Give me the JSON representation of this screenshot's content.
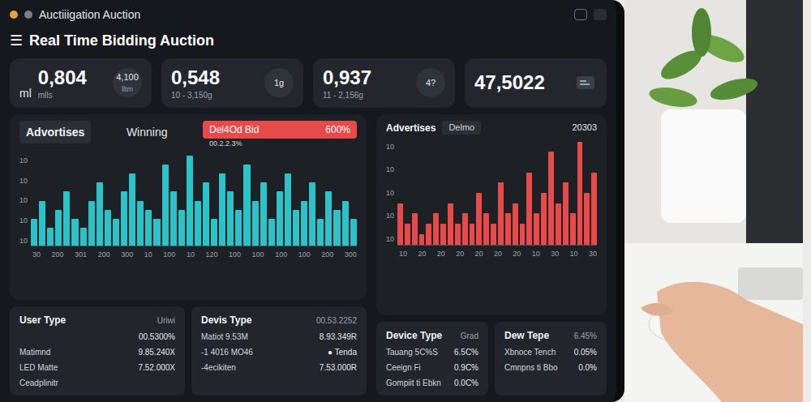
{
  "window": {
    "title": "Auctiiigation Auction"
  },
  "header": {
    "menu_icon": "☰",
    "title": "Real Time Bidding Auction"
  },
  "stats": [
    {
      "prefix": "ml",
      "value": "0,804",
      "sub": "mlls",
      "side": "4,100",
      "side_sub": "lltm"
    },
    {
      "value": "0,548",
      "sub": "10 - 3,150g",
      "side": "1g"
    },
    {
      "value": "0,937",
      "sub": "11 - 2,156g",
      "side": "4?"
    },
    {
      "value": "47,5022"
    }
  ],
  "main_chart": {
    "title": "Advortises",
    "status": "Winning",
    "badge": {
      "label": "Del4Od Bid",
      "value": "600%",
      "sub": "00.2.2.3%"
    },
    "y_ticks": [
      "10",
      "10",
      "10",
      "10",
      "10"
    ],
    "x_ticks": [
      "30",
      "200",
      "301",
      "200",
      "300",
      "10",
      "100",
      "10",
      "120",
      "100",
      "100",
      "100",
      "100",
      "200",
      "300"
    ],
    "color": "#2cc3c8",
    "values": [
      3,
      5,
      2,
      4,
      6,
      3,
      2,
      5,
      7,
      4,
      3,
      6,
      8,
      5,
      4,
      3,
      9,
      6,
      4,
      10,
      5,
      7,
      3,
      8,
      6,
      4,
      9,
      5,
      7,
      3,
      6,
      8,
      4,
      5,
      7,
      3,
      6,
      4,
      5,
      3
    ]
  },
  "side_chart": {
    "title": "Advertises",
    "tab": "Delmo",
    "value": "20303",
    "y_ticks": [
      "10",
      "10",
      "10",
      "10",
      "10"
    ],
    "x_ticks": [
      "10",
      "20",
      "20",
      "20",
      "20",
      "20",
      "20",
      "10",
      "30",
      "10",
      "30"
    ],
    "color": "#e84a4a",
    "values": [
      4,
      2,
      3,
      1,
      2,
      3,
      2,
      4,
      2,
      3,
      2,
      5,
      3,
      2,
      6,
      3,
      4,
      2,
      7,
      3,
      5,
      9,
      4,
      6,
      3,
      10,
      5,
      7
    ]
  },
  "bottom_cards": [
    {
      "title": "User Type",
      "unit": "Uriwi",
      "rows": [
        {
          "label": "",
          "value": "00.5300%"
        },
        {
          "label": "Matimnd",
          "value": "9.85.240X"
        },
        {
          "label": "LED Matte",
          "value": "7.52.000X"
        },
        {
          "label": "Ceadplinitr"
        }
      ]
    },
    {
      "title": "Devis Type",
      "unit": "00.53.2252",
      "rows": [
        {
          "label": "Matiot 9.53M",
          "value": "8.93.349R"
        },
        {
          "label": "-1 4016 MO46",
          "value": "● Tenda"
        },
        {
          "label": "-4ecikiten",
          "value": "7.53.000R"
        }
      ]
    }
  ],
  "device_cards": [
    {
      "title": "Device Type",
      "unit": "Grad",
      "rows": [
        {
          "label": "Tauang 5C%S",
          "value": "6.5C%"
        },
        {
          "label": "Ceeign Fi",
          "value": "0.9C%"
        },
        {
          "label": "Gompiit ti Ebkn",
          "value": "0.0C%"
        }
      ]
    },
    {
      "title": "Dew Tepe",
      "unit": "6.45%",
      "rows": [
        {
          "label": "Xbnoce Tench",
          "value": "0.05%"
        },
        {
          "label": "Cmnpns ti Bbo",
          "value": "0.0%"
        }
      ]
    }
  ]
}
